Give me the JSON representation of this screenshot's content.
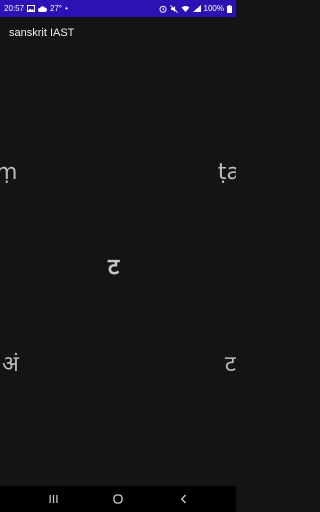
{
  "status_bar": {
    "time": "20:57",
    "temperature": "27°",
    "dot": "•",
    "battery": "100%",
    "icons_left": [
      "gallery-icon",
      "cloud-icon"
    ],
    "icons_right": [
      "alarm-icon",
      "mute-icon",
      "wifi-icon",
      "signal-icon",
      "battery-icon"
    ],
    "background": "#2a12b4"
  },
  "app_bar": {
    "title": "sanskrit IAST"
  },
  "glyphs": {
    "left_top": "ṃ",
    "right_top": "ṭa",
    "center": "ट",
    "left_bottom": "अं",
    "right_bottom": "ट"
  },
  "nav_bar": {
    "buttons": [
      "recent-apps",
      "home",
      "back"
    ]
  },
  "colors": {
    "background": "#141414",
    "glyph": "#bdbdbd",
    "status_bar": "#2a12b4",
    "nav_bar": "#000000"
  }
}
